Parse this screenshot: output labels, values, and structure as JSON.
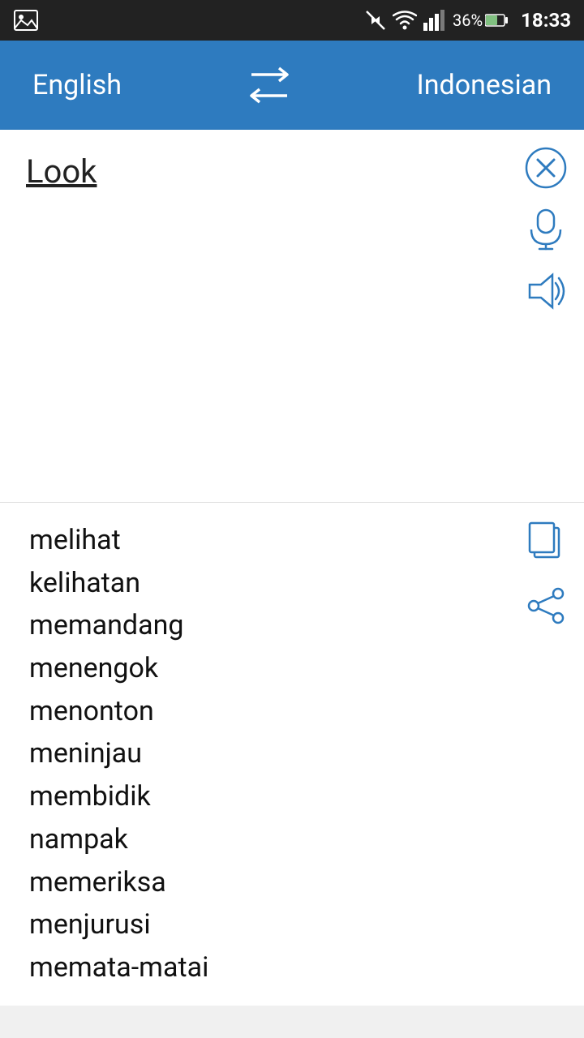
{
  "statusBar": {
    "time": "18:33",
    "battery": "36%"
  },
  "toolbar": {
    "sourceLang": "English",
    "targetLang": "Indonesian",
    "swapLabel": "⇄"
  },
  "inputArea": {
    "word": "Look",
    "clearLabel": "clear",
    "micLabel": "microphone",
    "speakerLabel": "speaker"
  },
  "translations": {
    "words": [
      "melihat",
      "kelihatan",
      "memandang",
      "menengok",
      "menonton",
      "meninjau",
      "membidik",
      "nampak",
      "memeriksa",
      "menjurusi",
      "memata-matai"
    ],
    "copyLabel": "copy",
    "shareLabel": "share"
  }
}
